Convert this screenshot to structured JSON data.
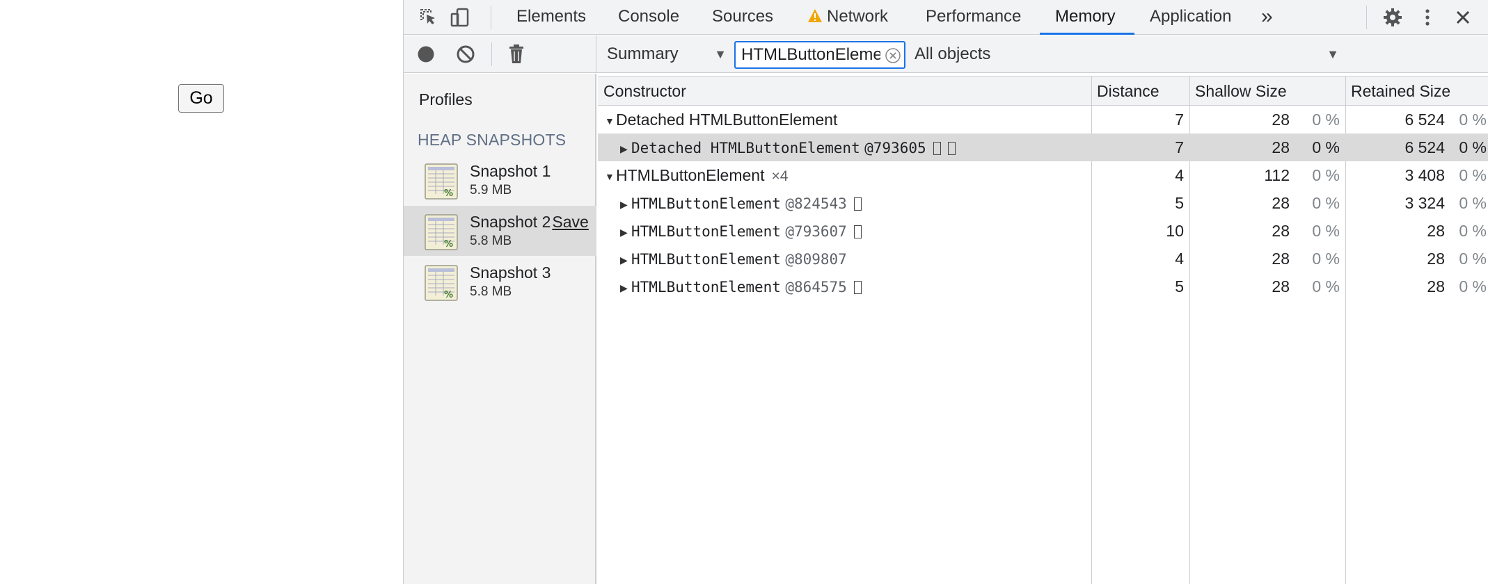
{
  "page": {
    "go_button": "Go"
  },
  "tabs": [
    {
      "label": "Elements"
    },
    {
      "label": "Console"
    },
    {
      "label": "Sources"
    },
    {
      "label": "Network"
    },
    {
      "label": "Performance"
    },
    {
      "label": "Memory"
    },
    {
      "label": "Application"
    }
  ],
  "tab_overflow": "»",
  "active_tab": "Memory",
  "toolbar": {
    "view": "Summary",
    "filter_value": "HTMLButtonElement",
    "objects": "All objects"
  },
  "sidebar": {
    "title": "Profiles",
    "section": "HEAP SNAPSHOTS",
    "snapshots": [
      {
        "name": "Snapshot 1",
        "size": "5.9 MB",
        "save": ""
      },
      {
        "name": "Snapshot 2",
        "size": "5.8 MB",
        "save": "Save"
      },
      {
        "name": "Snapshot 3",
        "size": "5.8 MB",
        "save": ""
      }
    ],
    "selected_index": 1
  },
  "table": {
    "columns": [
      "Constructor",
      "Distance",
      "Shallow Size",
      "Retained Size"
    ],
    "rows": [
      {
        "name": "Detached HTMLButtonElement",
        "id": "",
        "count": "",
        "distance": "7",
        "shallow": "28",
        "shallow_pct": "0 %",
        "retained": "6 524",
        "retained_pct": "0 %"
      },
      {
        "name": "Detached HTMLButtonElement",
        "id": "@793605",
        "count": "",
        "distance": "7",
        "shallow": "28",
        "shallow_pct": "0 %",
        "retained": "6 524",
        "retained_pct": "0 %"
      },
      {
        "name": "HTMLButtonElement",
        "id": "",
        "count": "×4",
        "distance": "4",
        "shallow": "112",
        "shallow_pct": "0 %",
        "retained": "3 408",
        "retained_pct": "0 %"
      },
      {
        "name": "HTMLButtonElement",
        "id": "@824543",
        "count": "",
        "distance": "5",
        "shallow": "28",
        "shallow_pct": "0 %",
        "retained": "3 324",
        "retained_pct": "0 %"
      },
      {
        "name": "HTMLButtonElement",
        "id": "@793607",
        "count": "",
        "distance": "10",
        "shallow": "28",
        "shallow_pct": "0 %",
        "retained": "28",
        "retained_pct": "0 %"
      },
      {
        "name": "HTMLButtonElement",
        "id": "@809807",
        "count": "",
        "distance": "4",
        "shallow": "28",
        "shallow_pct": "0 %",
        "retained": "28",
        "retained_pct": "0 %"
      },
      {
        "name": "HTMLButtonElement",
        "id": "@864575",
        "count": "",
        "distance": "5",
        "shallow": "28",
        "shallow_pct": "0 %",
        "retained": "28",
        "retained_pct": "0 %"
      }
    ]
  },
  "colors": {
    "accent": "#1a73e8",
    "warning": "#f2a600",
    "selected_row": "#dadada"
  },
  "icons": [
    "inspect-element-icon",
    "device-toolbar-icon",
    "warning-icon",
    "more-tabs-icon",
    "settings-gear-icon",
    "more-vertical-icon",
    "close-icon",
    "record-icon",
    "clear-icon",
    "trash-icon",
    "clear-filter-icon",
    "heap-snapshot-icon"
  ]
}
